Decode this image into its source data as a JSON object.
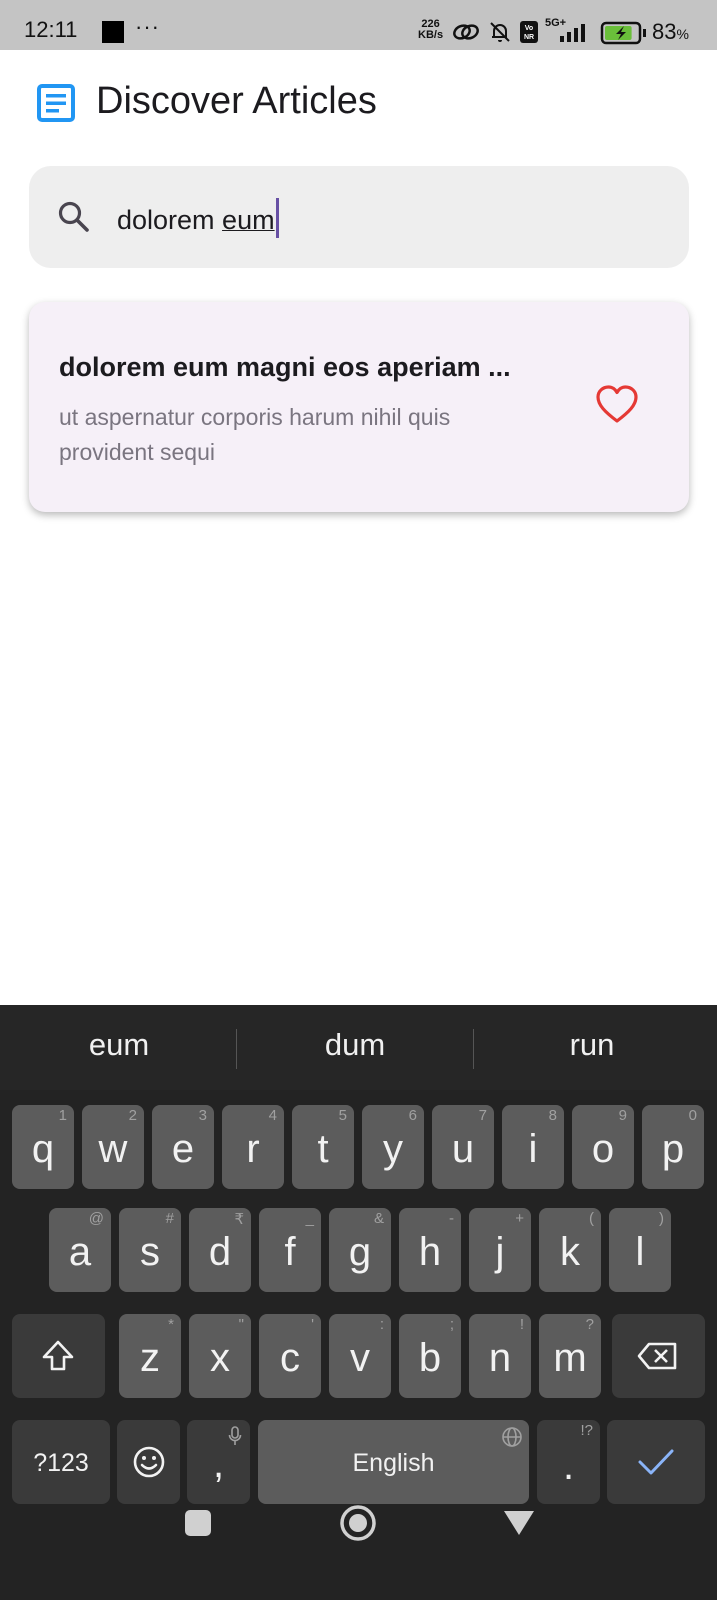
{
  "status_bar": {
    "time": "12:11",
    "dots": "···",
    "net_speed_value": "226",
    "net_speed_unit": "KB/s",
    "network": "5G+",
    "battery": "83",
    "battery_unit": "%",
    "battery_level": 0.83,
    "battery_color": "#6abf3a",
    "icons": [
      "link-icon",
      "bell-off-icon",
      "volte-icon",
      "signal-icon",
      "battery-charging-icon"
    ]
  },
  "header": {
    "title": "Discover Articles",
    "logo_icon": "article-icon",
    "logo_color": "#2196f3"
  },
  "search": {
    "value_plain": "dolorem ",
    "value_composing": "eum",
    "icon": "search-icon",
    "caret_color": "#6750a4"
  },
  "articles": [
    {
      "title": "dolorem eum magni eos aperiam ...",
      "subtitle_line1": "ut aspernatur corporis harum nihil quis",
      "subtitle_line2": "provident sequi",
      "favorite_icon": "heart-outline-icon",
      "favorite_color": "#e53935"
    }
  ],
  "keyboard": {
    "suggestions": [
      "eum",
      "dum",
      "run"
    ],
    "row1": [
      {
        "k": "q",
        "h": "1"
      },
      {
        "k": "w",
        "h": "2"
      },
      {
        "k": "e",
        "h": "3"
      },
      {
        "k": "r",
        "h": "4"
      },
      {
        "k": "t",
        "h": "5"
      },
      {
        "k": "y",
        "h": "6"
      },
      {
        "k": "u",
        "h": "7"
      },
      {
        "k": "i",
        "h": "8"
      },
      {
        "k": "o",
        "h": "9"
      },
      {
        "k": "p",
        "h": "0"
      }
    ],
    "row2": [
      {
        "k": "a",
        "h": "@"
      },
      {
        "k": "s",
        "h": "#"
      },
      {
        "k": "d",
        "h": "₹"
      },
      {
        "k": "f",
        "h": "_"
      },
      {
        "k": "g",
        "h": "&"
      },
      {
        "k": "h",
        "h": "-"
      },
      {
        "k": "j",
        "h": "+"
      },
      {
        "k": "k",
        "h": "("
      },
      {
        "k": "l",
        "h": ")"
      }
    ],
    "row3": [
      {
        "k": "z",
        "h": "*"
      },
      {
        "k": "x",
        "h": "\""
      },
      {
        "k": "c",
        "h": "'"
      },
      {
        "k": "v",
        "h": ":"
      },
      {
        "k": "b",
        "h": ";"
      },
      {
        "k": "n",
        "h": "!"
      },
      {
        "k": "m",
        "h": "?"
      }
    ],
    "symbols_label": "?123",
    "comma": ",",
    "space_label": "English",
    "period": ".",
    "period_hint": "!?",
    "shift_icon": "shift-icon",
    "backspace_icon": "backspace-icon",
    "emoji_icon": "emoji-icon",
    "mic_icon": "mic-icon",
    "globe_icon": "globe-icon",
    "enter_icon": "checkmark-icon",
    "accent_color": "#8ab4f8"
  },
  "nav": {
    "icons": [
      "recents-square-icon",
      "home-circle-icon",
      "back-triangle-icon"
    ]
  }
}
